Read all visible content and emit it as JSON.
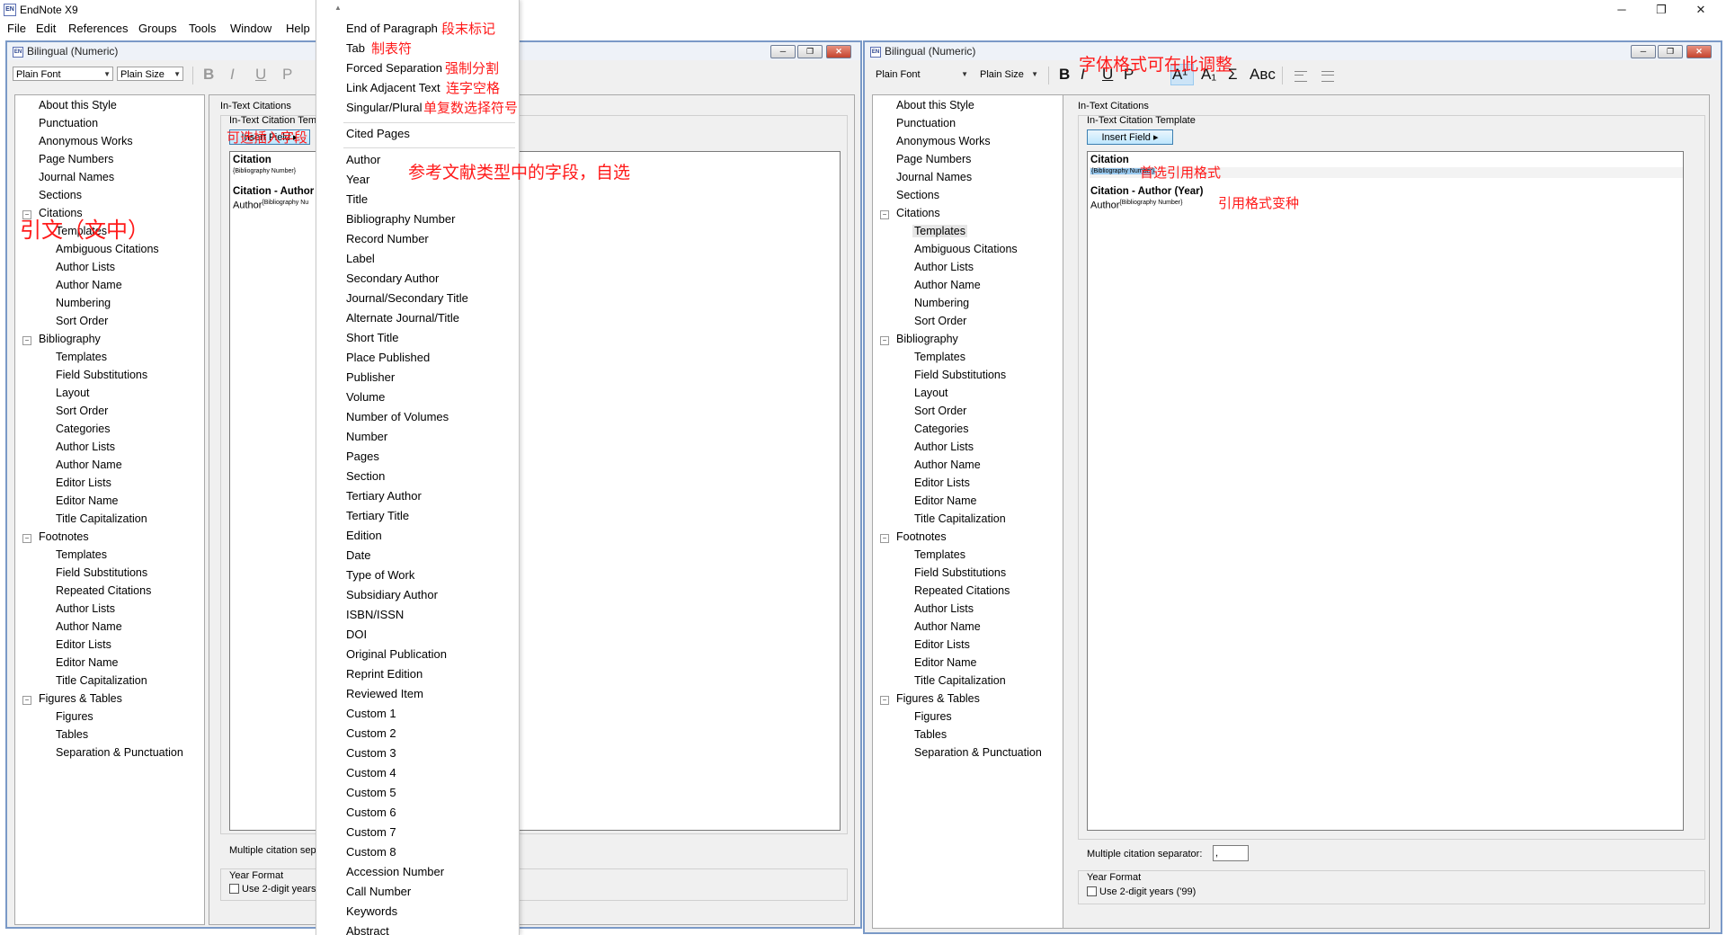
{
  "app": {
    "title": "EndNote X9",
    "logo": "EN",
    "minimize": "─",
    "maximize": "❐",
    "close": "✕"
  },
  "menu": [
    "File",
    "Edit",
    "References",
    "Groups",
    "Tools",
    "Window",
    "Help"
  ],
  "window": {
    "title": "Bilingual (Numeric)",
    "font_value": "Plain Font",
    "size_value": "Plain Size",
    "format_buttons": {
      "bold": "B",
      "italic": "I",
      "underline": "U",
      "plain": "P",
      "superscript": "A¹",
      "subscript": "A₁",
      "symbol": "Σ",
      "smallcaps": "Aʙᴄ"
    },
    "tree": {
      "about": "About this Style",
      "punctuation": "Punctuation",
      "anonymous": "Anonymous Works",
      "page_numbers": "Page Numbers",
      "journal_names": "Journal Names",
      "sections": "Sections",
      "citations": {
        "label": "Citations",
        "children": [
          "Templates",
          "Ambiguous Citations",
          "Author Lists",
          "Author Name",
          "Numbering",
          "Sort Order"
        ]
      },
      "bibliography": {
        "label": "Bibliography",
        "children": [
          "Templates",
          "Field Substitutions",
          "Layout",
          "Sort Order",
          "Categories",
          "Author Lists",
          "Author Name",
          "Editor Lists",
          "Editor Name",
          "Title Capitalization"
        ]
      },
      "footnotes": {
        "label": "Footnotes",
        "children": [
          "Templates",
          "Field Substitutions",
          "Repeated Citations",
          "Author Lists",
          "Author Name",
          "Editor Lists",
          "Editor Name",
          "Title Capitalization"
        ]
      },
      "figures": {
        "label": "Figures & Tables",
        "children": [
          "Figures",
          "Tables",
          "Separation & Punctuation"
        ]
      }
    },
    "panel": {
      "heading": "In-Text Citations",
      "template_label": "In-Text Citation Template",
      "template_label_left": "In-Text Citation Tem",
      "insert_field": "Insert Field",
      "citation_label": "Citation",
      "citation_value": "{Bibliography Number}",
      "citation_author_label": "Citation - Author (Year)",
      "citation_author_label_left": "Citation - Author",
      "citation_author_value_prefix": "Author",
      "citation_author_value_sup": "{Bibliography Number}",
      "citation_author_value_sup_left": "{Bibliography Nu",
      "separator_label": "Multiple citation separator:",
      "separator_label_left": "Multiple citation sepa",
      "separator_value": ",",
      "year_format": "Year Format",
      "two_digit": "Use 2-digit years ('99)",
      "two_digit_left": "Use 2-digit years"
    }
  },
  "dropdown": {
    "scroll_up": "▲",
    "items": [
      "End of Paragraph",
      "Tab",
      "Forced Separation",
      "Link Adjacent Text",
      "Singular/Plural"
    ],
    "cited_pages": "Cited Pages",
    "fields": [
      "Author",
      "Year",
      "Title",
      "Bibliography Number",
      "Record Number",
      "Label",
      "Secondary Author",
      "Journal/Secondary Title",
      "Alternate Journal/Title",
      "Short Title",
      "Place Published",
      "Publisher",
      "Volume",
      "Number of Volumes",
      "Number",
      "Pages",
      "Section",
      "Tertiary Author",
      "Tertiary Title",
      "Edition",
      "Date",
      "Type of Work",
      "Subsidiary Author",
      "ISBN/ISSN",
      "DOI",
      "Original Publication",
      "Reprint Edition",
      "Reviewed Item",
      "Custom 1",
      "Custom 2",
      "Custom 3",
      "Custom 4",
      "Custom 5",
      "Custom 6",
      "Custom 7",
      "Custom 8",
      "Accession Number",
      "Call Number",
      "Keywords",
      "Abstract"
    ]
  },
  "annotations": {
    "end_of_paragraph": "段末标记",
    "tab": "制表符",
    "forced_separation": "强制分割",
    "link_adjacent": "连字空格",
    "singular_plural": "单复数选择符号",
    "insert_field": "可选插入字段",
    "fields_note": "参考文献类型中的字段，自选",
    "citations_note": "引文（文中）",
    "font_note": "字体格式可在此调整",
    "preferred": "首选引用格式",
    "variant": "引用格式变种"
  },
  "colors": {
    "annotation": "#ff1a1a",
    "window_border": "#7a99c7",
    "highlight": "#99c9ef"
  }
}
